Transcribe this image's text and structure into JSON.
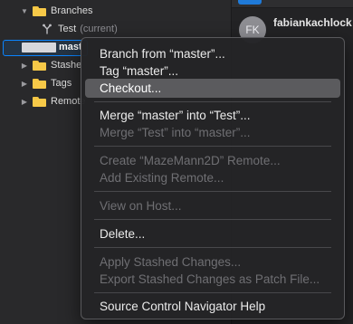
{
  "navigator": {
    "branches_folder": "Branches",
    "test_branch": "Test",
    "test_branch_status": "(current)",
    "selected_branch_partial": "mast",
    "stashed_folder": "Stashe",
    "tags_folder": "Tags",
    "remotes_folder": "Remote"
  },
  "inspector": {
    "avatar_initials": "FK",
    "author": "fabiankachlock"
  },
  "context_menu": {
    "branch_from": "Branch from “master”...",
    "tag": "Tag “master”...",
    "checkout": "Checkout...",
    "merge_into": "Merge “master” into “Test”...",
    "merge_from": "Merge “Test” into “master”...",
    "create_remote": "Create “MazeMann2D” Remote...",
    "add_remote": "Add Existing Remote...",
    "view_on_host": "View on Host...",
    "delete": "Delete...",
    "apply_stashed": "Apply Stashed Changes...",
    "export_stashed": "Export Stashed Changes as Patch File...",
    "help": "Source Control Navigator Help"
  },
  "colors": {
    "folder": "#f7c948",
    "selection_border": "#0a84ff",
    "menu_highlight": "#5b5b5e"
  }
}
